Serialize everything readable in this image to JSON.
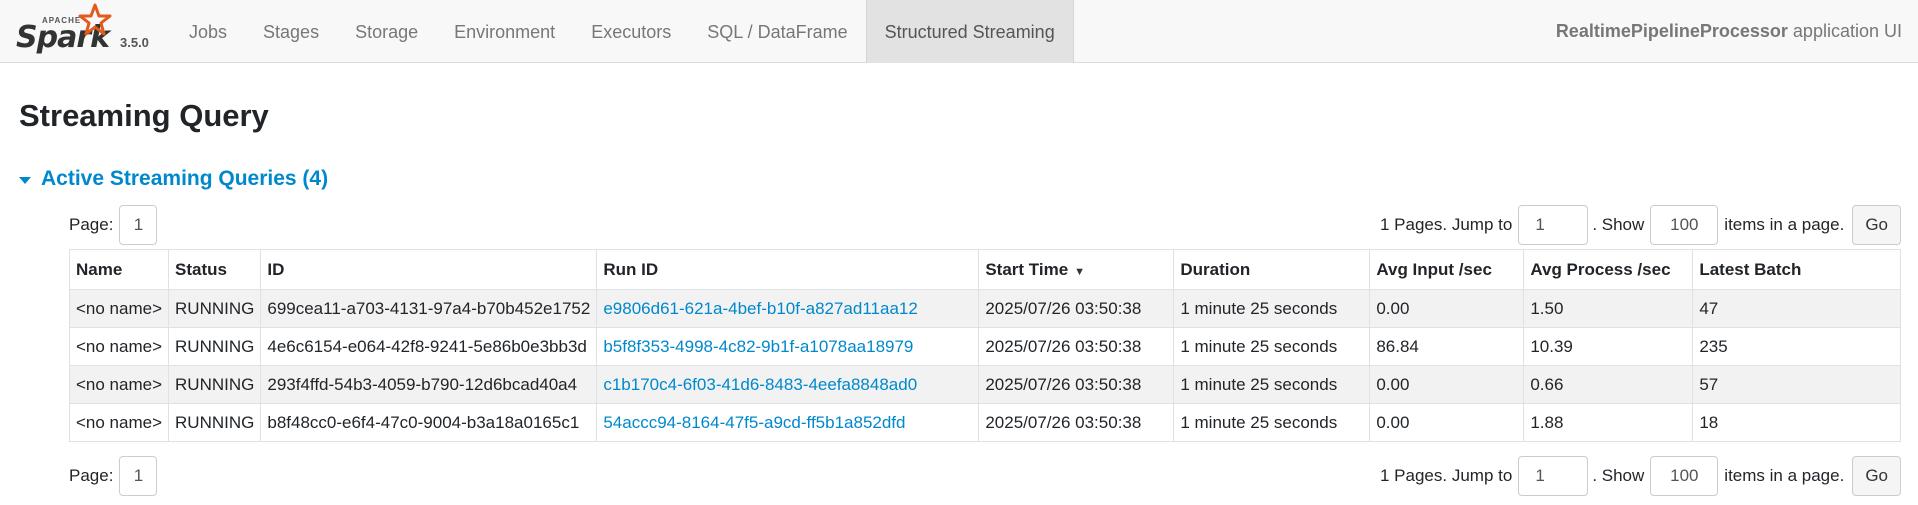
{
  "navbar": {
    "logo_apache": "APACHE",
    "logo_spark": "Spark",
    "version": "3.5.0",
    "tabs": [
      {
        "label": "Jobs"
      },
      {
        "label": "Stages"
      },
      {
        "label": "Storage"
      },
      {
        "label": "Environment"
      },
      {
        "label": "Executors"
      },
      {
        "label": "SQL / DataFrame"
      },
      {
        "label": "Structured Streaming"
      }
    ],
    "active_tab": "Structured Streaming",
    "app_name": "RealtimePipelineProcessor",
    "app_suffix": " application UI"
  },
  "page_title": "Streaming Query",
  "section": {
    "title": "Active Streaming Queries (4)"
  },
  "pager": {
    "page_label": "Page:",
    "current_page": "1",
    "pages_text": "1 Pages. Jump to",
    "jump_value": "1",
    "show_text": ". Show",
    "show_value": "100",
    "items_text": "items in a page.",
    "go_label": "Go"
  },
  "table": {
    "headers": [
      "Name",
      "Status",
      "ID",
      "Run ID",
      "Start Time",
      "Duration",
      "Avg Input /sec",
      "Avg Process /sec",
      "Latest Batch"
    ],
    "sort_indicator": "▼",
    "rows": [
      [
        "<no name>",
        "RUNNING",
        "699cea11-a703-4131-97a4-b70b452e1752",
        "e9806d61-621a-4bef-b10f-a827ad11aa12",
        "2025/07/26 03:50:38",
        "1 minute 25 seconds",
        "0.00",
        "1.50",
        "47"
      ],
      [
        "<no name>",
        "RUNNING",
        "4e6c6154-e064-42f8-9241-5e86b0e3bb3d",
        "b5f8f353-4998-4c82-9b1f-a1078aa18979",
        "2025/07/26 03:50:38",
        "1 minute 25 seconds",
        "86.84",
        "10.39",
        "235"
      ],
      [
        "<no name>",
        "RUNNING",
        "293f4ffd-54b3-4059-b790-12d6bcad40a4",
        "c1b170c4-6f03-41d6-8483-4eefa8848ad0",
        "2025/07/26 03:50:38",
        "1 minute 25 seconds",
        "0.00",
        "0.66",
        "57"
      ],
      [
        "<no name>",
        "RUNNING",
        "b8f48cc0-e6f4-47c0-9004-b3a18a0165c1",
        "54accc94-8164-47f5-a9cd-ff5b1a852dfd",
        "2025/07/26 03:50:38",
        "1 minute 25 seconds",
        "0.00",
        "1.88",
        "18"
      ]
    ]
  },
  "colors": {
    "link": "#0088cc",
    "logo_star": "#e25a1c"
  }
}
